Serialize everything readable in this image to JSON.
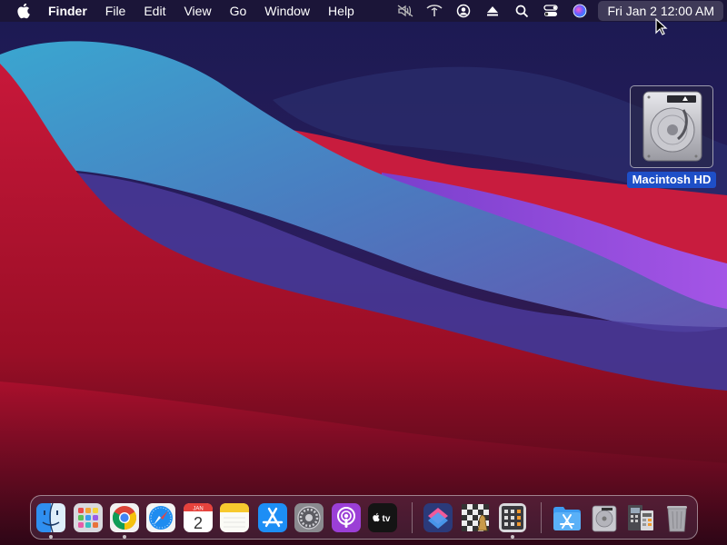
{
  "menubar": {
    "apple_icon": "apple-logo-icon",
    "app_name": "Finder",
    "menus": [
      "File",
      "Edit",
      "View",
      "Go",
      "Window",
      "Help"
    ],
    "status_icons": [
      "mute-icon",
      "wifi-icon",
      "user-icon",
      "eject-icon",
      "search-icon",
      "control-center-icon",
      "siri-icon"
    ],
    "clock": "Fri Jan 2  12:00 AM"
  },
  "desktop": {
    "icon_label": "Macintosh HD",
    "icon_name": "hard-drive-icon"
  },
  "dock": {
    "apps": [
      {
        "name": "finder-icon",
        "running": true
      },
      {
        "name": "launchpad-icon",
        "running": false
      },
      {
        "name": "chrome-icon",
        "running": true
      },
      {
        "name": "safari-icon",
        "running": false
      },
      {
        "name": "calendar-icon",
        "running": false,
        "month": "JAN",
        "day": "2"
      },
      {
        "name": "notes-icon",
        "running": false
      },
      {
        "name": "app-store-icon",
        "running": false
      },
      {
        "name": "system-preferences-icon",
        "running": false
      },
      {
        "name": "podcasts-icon",
        "running": false
      },
      {
        "name": "apple-tv-icon",
        "running": false,
        "label": "tv"
      },
      {
        "name": "shortcuts-icon",
        "running": false
      },
      {
        "name": "chess-icon",
        "running": false
      },
      {
        "name": "calculator-icon",
        "running": true
      },
      {
        "name": "applications-folder-icon",
        "running": false
      },
      {
        "name": "hard-drive-stack-icon",
        "running": false
      },
      {
        "name": "documents-stack-icon",
        "running": false
      },
      {
        "name": "trash-icon",
        "running": false
      }
    ]
  }
}
